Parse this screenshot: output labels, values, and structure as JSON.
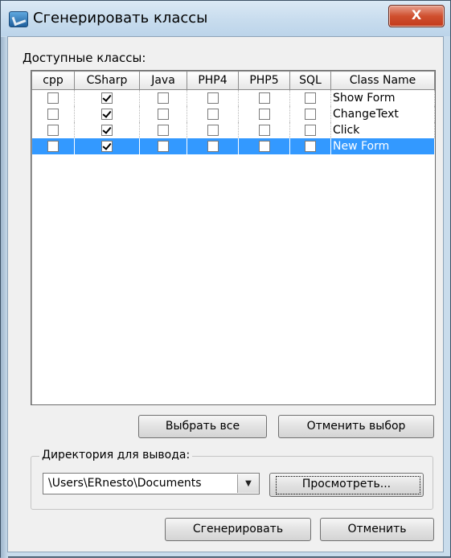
{
  "window": {
    "title": "Сгенерировать классы",
    "close_label": "X"
  },
  "classes_label": "Доступные классы:",
  "table": {
    "columns": [
      "cpp",
      "CSharp",
      "Java",
      "PHP4",
      "PHP5",
      "SQL",
      "Class Name"
    ],
    "rows": [
      {
        "name": "Show Form",
        "checks": [
          false,
          true,
          false,
          false,
          false,
          false
        ],
        "selected": false
      },
      {
        "name": "ChangeText",
        "checks": [
          false,
          true,
          false,
          false,
          false,
          false
        ],
        "selected": false
      },
      {
        "name": "Click",
        "checks": [
          false,
          true,
          false,
          false,
          false,
          false
        ],
        "selected": false
      },
      {
        "name": "New Form",
        "checks": [
          false,
          true,
          false,
          false,
          false,
          false
        ],
        "selected": true
      }
    ]
  },
  "buttons": {
    "select_all": "Выбрать все",
    "deselect": "Отменить выбор",
    "browse": "Просмотреть...",
    "generate": "Сгенерировать",
    "cancel": "Отменить"
  },
  "output": {
    "group_label": "Директория для вывода:",
    "path": "\\Users\\ERnesto\\Documents"
  },
  "colors": {
    "selection": "#3399ff",
    "close_button": "#c9462a"
  }
}
